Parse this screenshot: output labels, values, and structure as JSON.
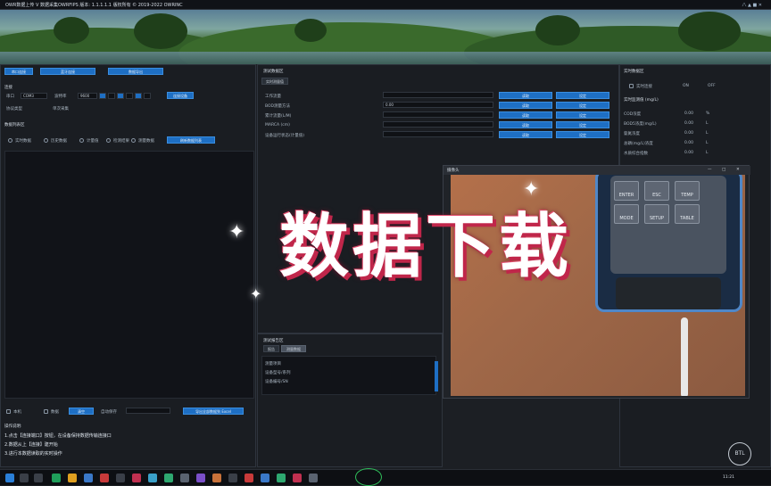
{
  "titlebar": {
    "title": "OWR数据上传 V 数据采集OWRFIPS 版本: 1.1.1.1.1 版权所有 © 2019-2022 OWRINC",
    "right_text": "八 ▲ ■ ✕"
  },
  "left_panel": {
    "top_buttons": [
      "串口连接",
      "蓝牙连接",
      "数据导出"
    ],
    "conn_section": "连接",
    "port_label": "串口",
    "port_value": "COM3",
    "baud_label": "波特率",
    "baud_value": "9600",
    "connect_button": "连接设备",
    "protocol_label": "协议类型",
    "protocol_value": "单次采集",
    "data_section": "数据列表区",
    "radio_options": [
      "实时数据",
      "历史数据",
      "计量值",
      "检测结果",
      "测量数据"
    ],
    "refresh_button": "刷新数据列表",
    "bottom_controls": {
      "label1": "本机",
      "label2": "数据",
      "button1": "清空",
      "label3": "自动保存",
      "button2": "导出全部数据到 Excel"
    },
    "instructions_title": "操作说明:",
    "instructions": [
      "1.点击【连接端口】按钮，在设备保持数据传输连接口",
      "2.数据从上【连接】建开始",
      "3.进行本数据读取的实时操作"
    ]
  },
  "middle_panel": {
    "section": "测试数据区",
    "tab": "实时测量值",
    "rows": [
      {
        "label": "工作流量",
        "value": ""
      },
      {
        "label": "BOD测量方法",
        "value": "0.00"
      },
      {
        "label": "累计流量(L/M)",
        "value": ""
      },
      {
        "label": "MARCA (cm)",
        "value": ""
      },
      {
        "label": "设备运行状态(计量值)",
        "value": ""
      }
    ],
    "blue_buttons": [
      "读取",
      "设定",
      "读取",
      "设定",
      "读取",
      "设定",
      "读取",
      "设定",
      "读取",
      "设定"
    ]
  },
  "lower_middle": {
    "section": "测试报告区",
    "tabs": [
      "报告",
      "测量数据"
    ],
    "lines": [
      "测量项目",
      "设备型号/系列",
      "设备编号/SN"
    ]
  },
  "right_panel": {
    "section": "实时数据区",
    "toggle_label": "实时连接",
    "toggle_values": [
      "ON",
      "OFF"
    ],
    "sub_section": "实时监测值 (mg/L)",
    "readings": [
      {
        "label": "COD浓度",
        "value": "0.00",
        "unit": "%"
      },
      {
        "label": "BOD5浓度(mg/L)",
        "value": "0.00",
        "unit": "L"
      },
      {
        "label": "氨氮浓度",
        "value": "0.00",
        "unit": "L"
      },
      {
        "label": "总磷(mg/L)浓度",
        "value": "0.00",
        "unit": "L"
      },
      {
        "label": "水质综合指数",
        "value": "0.00",
        "unit": "L"
      }
    ]
  },
  "camera_window": {
    "title": "摄像头",
    "controls": [
      "—",
      "□",
      "✕"
    ],
    "device_keys": [
      "ENTER",
      "ESC",
      "TEMP",
      "MODE",
      "SETUP",
      "TABLE"
    ]
  },
  "overlay": {
    "text": "数据下载"
  },
  "logo": {
    "text": "BTL"
  },
  "taskbar": {
    "icons": [
      "start-icon",
      "search-icon",
      "task-view-icon",
      "browser-icon",
      "folder-icon",
      "app-icon"
    ],
    "clock": "11:21"
  }
}
